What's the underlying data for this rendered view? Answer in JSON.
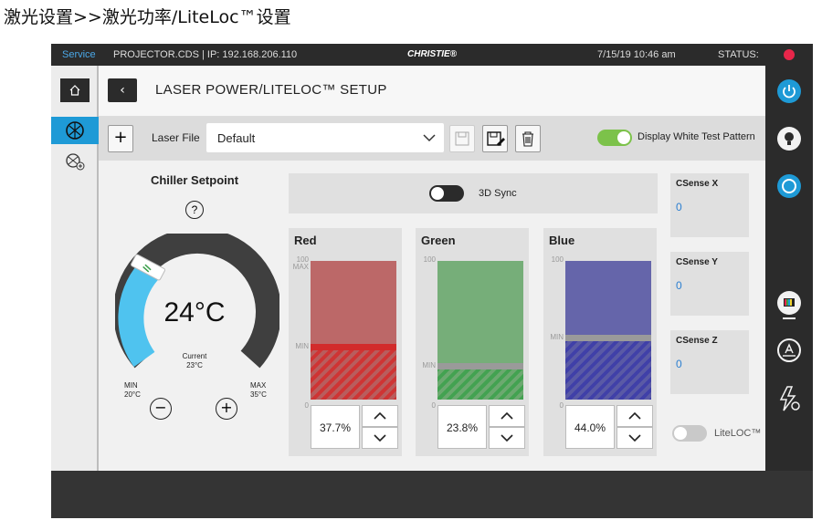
{
  "caption": "激光设置>>激光功率/LiteLoc™设置",
  "topbar": {
    "service": "Service",
    "device": "PROJECTOR.CDS  |  IP: 192.168.206.110",
    "brand": "CHRISTIE®",
    "datetime": "7/15/19   10:46 am",
    "status_label": "STATUS:",
    "status_color": "#e8264a"
  },
  "header": {
    "title": "LASER POWER/LITELOC™ SETUP"
  },
  "toolbar": {
    "add_label": "+",
    "laser_file_label": "Laser File",
    "laser_file_value": "Default",
    "display_white_label": "Display White Test Pattern",
    "display_white_on": true
  },
  "chiller": {
    "title": "Chiller Setpoint",
    "help": "?",
    "setpoint": "24°C",
    "current_label": "Current",
    "current_value": "23°C",
    "min_label": "MIN",
    "min_value": "20°C",
    "max_label": "MAX",
    "max_value": "35°C",
    "decrease": "−",
    "increase": "+"
  },
  "sync": {
    "label": "3D Sync",
    "on": false
  },
  "channels": [
    {
      "name": "Red",
      "percent": "37.7%",
      "level": 0.377,
      "min_level": 0.377,
      "color": "#d22b2b",
      "fill": "#b85b5b",
      "top_label": "100",
      "max_label": "MAX",
      "min_label": "MIN",
      "zero_label": "0"
    },
    {
      "name": "Green",
      "percent": "23.8%",
      "level": 0.238,
      "min_level": 0.238,
      "color": "#3aa04a",
      "fill": "#6aa86e",
      "top_label": "100",
      "max_label": "",
      "min_label": "MIN",
      "zero_label": "0"
    },
    {
      "name": "Blue",
      "percent": "44.0%",
      "level": 0.44,
      "min_level": 0.44,
      "color": "#3a3aa8",
      "fill": "#5858a4",
      "top_label": "100",
      "max_label": "",
      "min_label": "MIN",
      "zero_label": "0"
    }
  ],
  "csense": [
    {
      "label": "CSense X",
      "value": "0"
    },
    {
      "label": "CSense Y",
      "value": "0"
    },
    {
      "label": "CSense Z",
      "value": "0"
    }
  ],
  "liteloc": {
    "label": "LiteLOC™",
    "on": false
  }
}
